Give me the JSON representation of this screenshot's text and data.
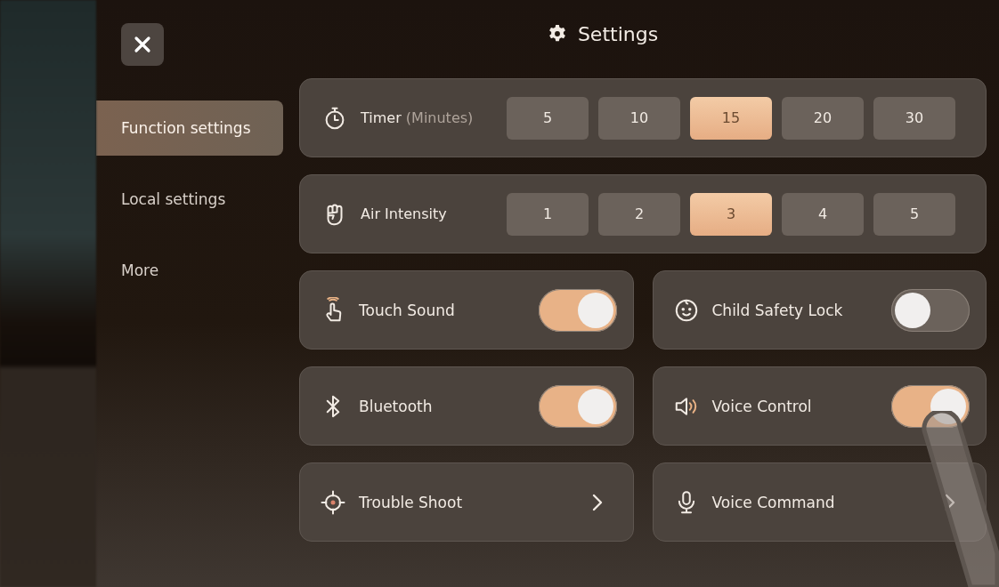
{
  "header": {
    "title": "Settings"
  },
  "sidebar": {
    "items": [
      {
        "label": "Function settings",
        "selected": true
      },
      {
        "label": "Local settings",
        "selected": false
      },
      {
        "label": "More",
        "selected": false
      }
    ]
  },
  "option_rows": [
    {
      "label": "Timer",
      "unit": "(Minutes)",
      "options": [
        {
          "label": "5",
          "selected": false
        },
        {
          "label": "10",
          "selected": false
        },
        {
          "label": "15",
          "selected": true
        },
        {
          "label": "20",
          "selected": false
        },
        {
          "label": "30",
          "selected": false
        }
      ]
    },
    {
      "label": "Air Intensity",
      "options": [
        {
          "label": "1",
          "selected": false
        },
        {
          "label": "2",
          "selected": false
        },
        {
          "label": "3",
          "selected": true
        },
        {
          "label": "4",
          "selected": false
        },
        {
          "label": "5",
          "selected": false
        }
      ]
    }
  ],
  "tiles": [
    {
      "kind": "toggle",
      "label": "Touch Sound",
      "on": true
    },
    {
      "kind": "toggle",
      "label": "Child Safety Lock",
      "on": false
    },
    {
      "kind": "toggle",
      "label": "Bluetooth",
      "on": true
    },
    {
      "kind": "toggle",
      "label": "Voice Control",
      "on": true
    },
    {
      "kind": "link",
      "label": "Trouble Shoot"
    },
    {
      "kind": "link",
      "label": "Voice Command"
    }
  ]
}
